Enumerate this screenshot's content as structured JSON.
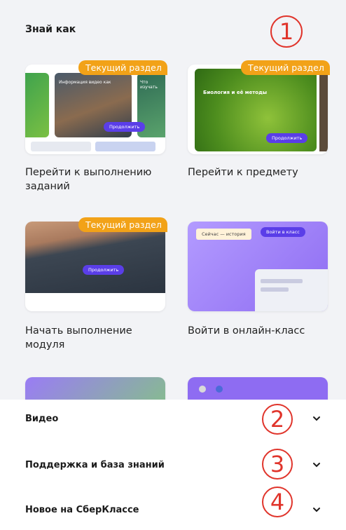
{
  "section": {
    "title": "Знай как"
  },
  "markers": [
    "1",
    "2",
    "3",
    "4"
  ],
  "cards": [
    {
      "label": "Перейти к выполнению заданий",
      "badge": "Текущий раздел",
      "thumb_titles": [
        "Информация видео как",
        "Что изучать"
      ],
      "thumb_button": "Продолжить"
    },
    {
      "label": "Перейти к предмету",
      "badge": "Текущий раздел",
      "thumb_title": "Биология и её методы",
      "thumb_button": "Продолжить"
    },
    {
      "label": "Начать выполнение модуля",
      "badge": "Текущий раздел",
      "thumb_button": "Продолжить"
    },
    {
      "label": "Войти в онлайн-класс",
      "thumb_chip": "Сейчас — история",
      "thumb_button": "Войти в класс"
    }
  ],
  "accordion": [
    {
      "label": "Видео"
    },
    {
      "label": "Поддержка и база знаний"
    },
    {
      "label": "Новое на СберКлассе"
    }
  ],
  "colors": {
    "badge": "#f2a218",
    "accent": "#5a3ee8",
    "marker": "#e0342b"
  }
}
